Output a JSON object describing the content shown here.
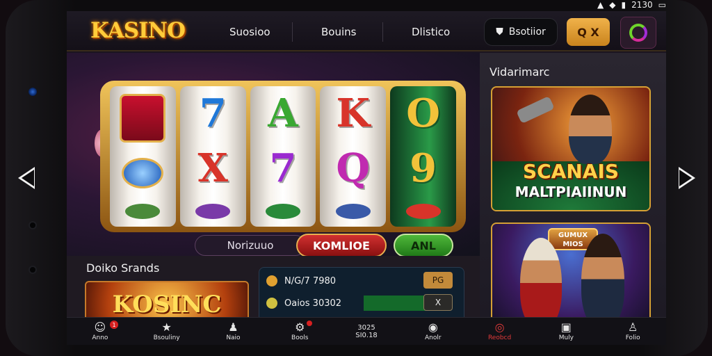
{
  "status": {
    "time": "2130"
  },
  "header": {
    "logo": "KASINO",
    "nav": [
      "Suosioo",
      "Bouins",
      "Dlistico"
    ],
    "login_label": "Bsotiior",
    "search_label": "Q X"
  },
  "slot": {
    "reels": [
      [
        "",
        "",
        ""
      ],
      [
        "7",
        "X",
        ""
      ],
      [
        "A",
        "7",
        ""
      ],
      [
        "K",
        "Q",
        ""
      ],
      [
        "O",
        "9",
        ""
      ]
    ],
    "bar_label": "Norizuuo",
    "red_button": "KOMLIOE",
    "green_button": "ANL"
  },
  "right": {
    "title": "Vidarimarc",
    "promo1_line1": "SCANAIS",
    "promo1_line2": "MALTPIAIINUN",
    "promo2_badge": "GUMUX MIOS"
  },
  "lower": {
    "section_title": "Doiko Srands",
    "card_text": "KOSINC",
    "bets": [
      {
        "label": "N/G/7 7980",
        "tag": "PG"
      },
      {
        "label": "Oaios 30302",
        "tag": "X"
      }
    ]
  },
  "tabs": [
    {
      "icon": "☺",
      "label": "Anno",
      "badge": "1"
    },
    {
      "icon": "★",
      "label": "Bsouliny"
    },
    {
      "icon": "♟",
      "label": "Naio"
    },
    {
      "icon": "⚙",
      "label": "Bools",
      "badge": ""
    },
    {
      "icon": "",
      "label": "3025\nSI0.18"
    },
    {
      "icon": "◉",
      "label": "Anolr"
    },
    {
      "icon": "◎",
      "label": "Reobcd"
    },
    {
      "icon": "▣",
      "label": "Muly"
    },
    {
      "icon": "♙",
      "label": "Folio"
    }
  ],
  "colors": {
    "accent_gold": "#d5a034",
    "active_tab": "#e33a3a"
  }
}
